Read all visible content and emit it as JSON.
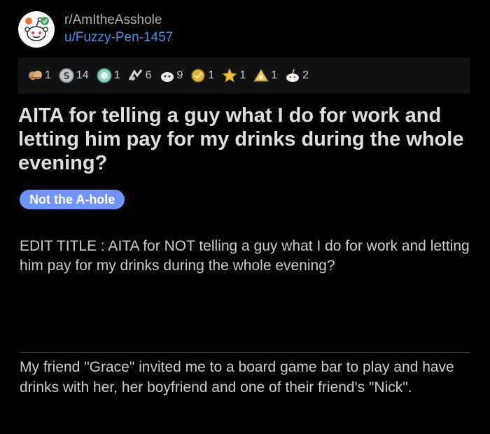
{
  "post": {
    "subreddit": "r/AmItheAsshole",
    "author": "u/Fuzzy-Pen-1457",
    "title": "AITA for telling a guy what I do for work and letting him pay for my drinks during the whole evening?",
    "flair": "Not the A-hole",
    "edit": "EDIT TITLE : AITA for NOT telling a guy what I do for work and letting him pay for my drinks during the whole evening?",
    "body": "My friend \"Grace\" invited me to a board game bar to play and have drinks with her, her boyfriend and one of their friend's \"Nick\"."
  },
  "awards": [
    {
      "icon": "hands-award-icon",
      "count": "1"
    },
    {
      "icon": "silver-coin-icon",
      "count": "14"
    },
    {
      "icon": "wholesome-award-icon",
      "count": "1"
    },
    {
      "icon": "helpful-award-icon",
      "count": "6"
    },
    {
      "icon": "snoo-award-icon",
      "count": "9"
    },
    {
      "icon": "gold-award-icon",
      "count": "1"
    },
    {
      "icon": "star-award-icon",
      "count": "1"
    },
    {
      "icon": "platinum-award-icon",
      "count": "1"
    },
    {
      "icon": "cake-award-icon",
      "count": "2"
    }
  ],
  "colors": {
    "background": "#000000",
    "link": "#4a8fe0",
    "flair_bg": "#7193ff"
  }
}
